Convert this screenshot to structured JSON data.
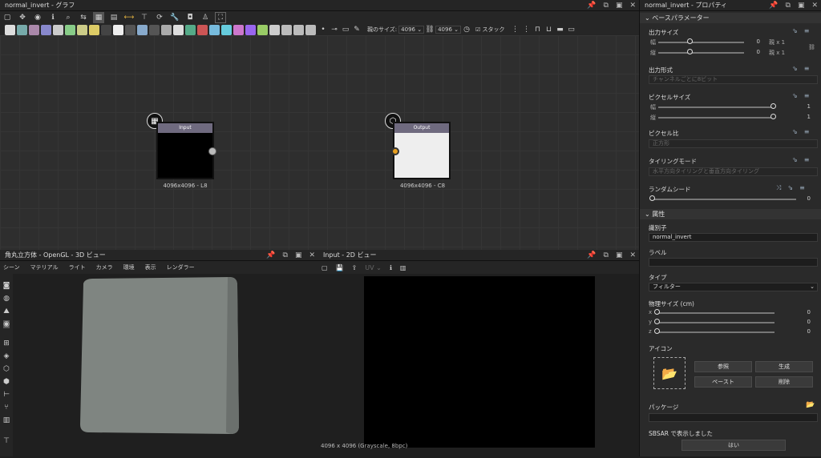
{
  "graph": {
    "title": "normal_invert - グラフ",
    "parent_size_label": "親のサイズ:",
    "parent_size_value": "4096",
    "size_value": "4096",
    "stack_label": "スタック"
  },
  "nodes": {
    "input": {
      "header": "Input",
      "caption": "4096x4096 - L8",
      "icon": "checker-icon"
    },
    "output": {
      "header": "Output",
      "caption": "4096x4096 - C8",
      "icon": "cube-icon"
    }
  },
  "view3d": {
    "title": "角丸立方体 - OpenGL - 3D ビュー",
    "menu": [
      "シーン",
      "マテリアル",
      "ライト",
      "カメラ",
      "環境",
      "表示",
      "レンダラー"
    ]
  },
  "view2d": {
    "title": "Input - 2D ビュー",
    "uv_label": "UV",
    "status": "4096 x 4096 (Grayscale, 8bpc)"
  },
  "props": {
    "title": "normal_invert - プロパティ",
    "base_section": "ベースパラメーター",
    "output_size": {
      "label": "出力サイズ",
      "width_label": "幅",
      "height_label": "縦",
      "width_val": "0",
      "height_val": "0",
      "width_mult": "親 x 1",
      "height_mult": "親 x 1"
    },
    "output_format": {
      "label": "出力形式",
      "value": "チャンネルごとに8ビット"
    },
    "pixel_size": {
      "label": "ピクセルサイズ",
      "width_label": "幅",
      "height_label": "縦",
      "width_val": "1",
      "height_val": "1"
    },
    "pixel_ratio": {
      "label": "ピクセル比",
      "value": "正方形"
    },
    "tiling": {
      "label": "タイリングモード",
      "value": "水平方向タイリングと垂直方向タイリング"
    },
    "random_seed": {
      "label": "ランダムシード",
      "value": "0"
    },
    "attr_section": "属性",
    "identifier": {
      "label": "識別子",
      "value": "normal_invert"
    },
    "label": {
      "label": "ラベル",
      "value": ""
    },
    "type": {
      "label": "タイプ",
      "value": "フィルター"
    },
    "physical_size": {
      "label": "物理サイズ (cm)",
      "x_label": "x",
      "y_label": "y",
      "z_label": "z",
      "x_val": "0",
      "y_val": "0",
      "z_val": "0"
    },
    "icon": {
      "label": "アイコン",
      "browse": "参照",
      "generate": "生成",
      "paste": "ペースト",
      "delete": "削除"
    },
    "package": {
      "label": "パッケージ"
    },
    "sbsar": {
      "label": "SBSAR で表示しました",
      "value": "はい"
    }
  }
}
